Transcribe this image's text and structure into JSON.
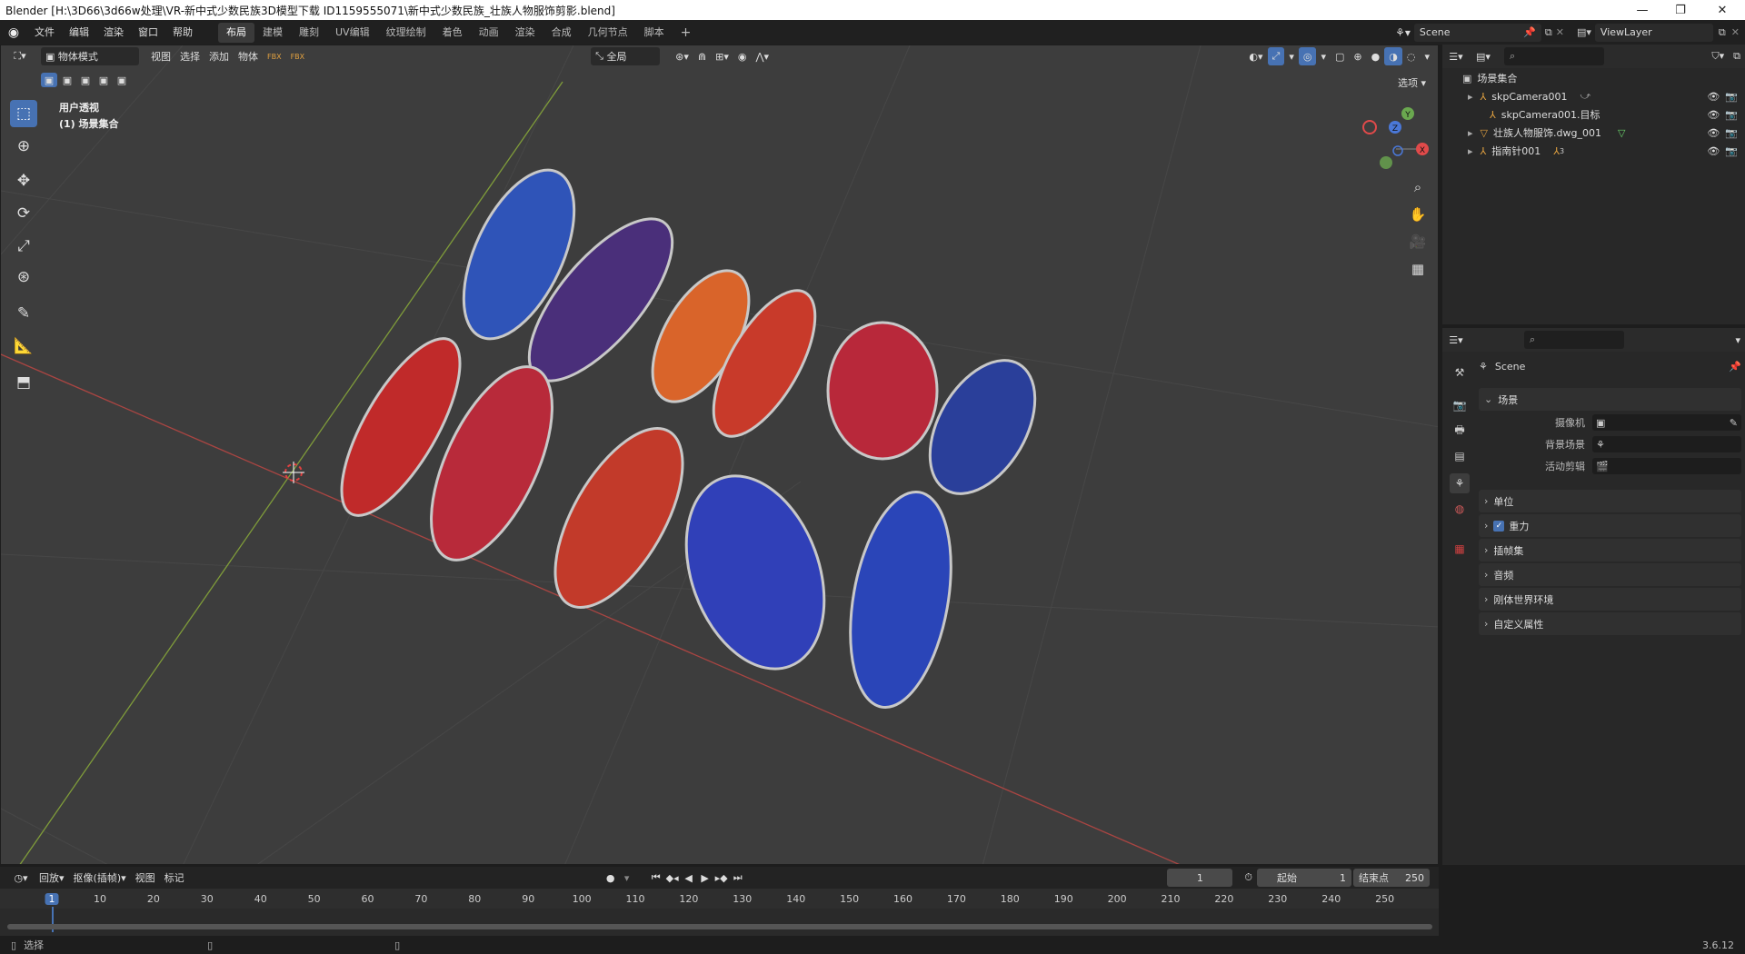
{
  "window": {
    "title": "Blender [H:\\3D66\\3d66w处理\\VR-新中式少数民族3D模型下载 ID1159555071\\新中式少数民族_壮族人物服饰剪影.blend]",
    "minimize": "—",
    "maximize": "❐",
    "close": "✕"
  },
  "menubar": {
    "items": [
      "文件",
      "编辑",
      "渲染",
      "窗口",
      "帮助"
    ],
    "workspaces": [
      "布局",
      "建模",
      "雕刻",
      "UV编辑",
      "纹理绘制",
      "着色",
      "动画",
      "渲染",
      "合成",
      "几何节点",
      "脚本"
    ],
    "active_workspace": "布局",
    "add_tab": "+",
    "scene_name": "Scene",
    "view_layer": "ViewLayer"
  },
  "viewport": {
    "mode": "物体模式",
    "menus": [
      "视图",
      "选择",
      "添加",
      "物体"
    ],
    "transform_orientation": "全局",
    "options_label": "选项",
    "overlay_line1": "用户透视",
    "overlay_line2": "(1) 场景集合",
    "gizmo_axes": {
      "x": "X",
      "y": "Y",
      "z": "Z"
    },
    "fbx_label": "FBX"
  },
  "outliner": {
    "root": "场景集合",
    "items": [
      {
        "name": "skpCamera001",
        "expandable": true
      },
      {
        "name": "skpCamera001.目标",
        "expandable": false
      },
      {
        "name": "壮族人物服饰.dwg_001",
        "expandable": true
      },
      {
        "name": "指南针001",
        "expandable": true,
        "badge": "3"
      }
    ]
  },
  "properties": {
    "scene_title": "Scene",
    "section_scene": "场景",
    "rows": [
      {
        "label": "摄像机",
        "value": ""
      },
      {
        "label": "背景场景",
        "value": ""
      },
      {
        "label": "活动剪辑",
        "value": ""
      }
    ],
    "collapsed_sections": [
      "单位",
      "重力",
      "插帧集",
      "音频",
      "刚体世界环境",
      "自定义属性"
    ],
    "gravity_checked": true
  },
  "timeline": {
    "menus": [
      "回放",
      "抠像(插帧)",
      "视图",
      "标记"
    ],
    "current_frame": "1",
    "start_label": "起始",
    "start_value": "1",
    "end_label": "结束点",
    "end_value": "250",
    "ticks": [
      "1",
      "10",
      "20",
      "30",
      "40",
      "50",
      "60",
      "70",
      "80",
      "90",
      "100",
      "110",
      "120",
      "130",
      "140",
      "150",
      "160",
      "170",
      "180",
      "190",
      "200",
      "210",
      "220",
      "230",
      "240",
      "250"
    ]
  },
  "statusbar": {
    "select_label": "选择",
    "version": "3.6.12"
  },
  "colors": {
    "accent": "#4772b3",
    "axis_x": "#c0392b",
    "axis_y": "#8bb33b",
    "viewport_bg": "#3d3d3d",
    "panel_bg": "#282828"
  }
}
